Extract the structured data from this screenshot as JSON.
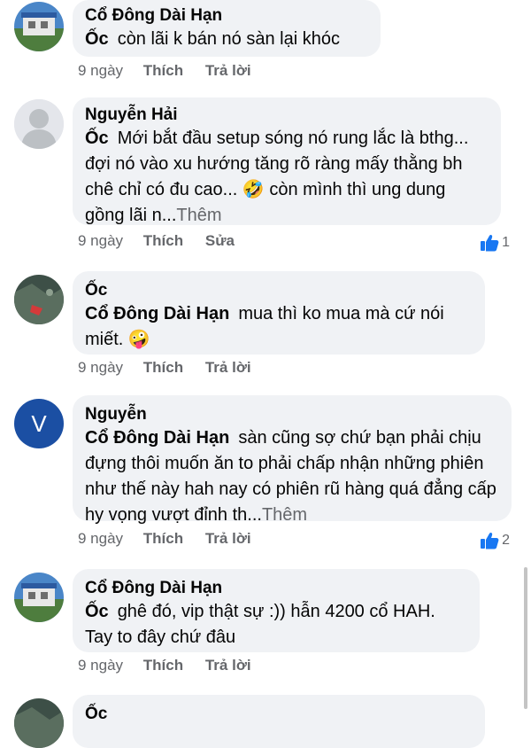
{
  "comments": [
    {
      "author": "Cổ Đông Dài Hạn",
      "tag": "Ốc",
      "text": "còn lãi k bán nó sàn lại khóc",
      "more": "",
      "time": "9 ngày",
      "like_label": "Thích",
      "action_label": "Trả lời",
      "reaction_count": ""
    },
    {
      "author": "Nguyễn Hải",
      "tag": "Ốc",
      "text": "Mới bắt đầu setup sóng nó rung lắc là bthg... đợi nó vào xu hướng tăng rõ ràng mấy thằng bh chê chỉ có đu cao... 🤣 còn mình thì ung dung gồng lãi n...",
      "more": "Thêm",
      "time": "9 ngày",
      "like_label": "Thích",
      "action_label": "Sửa",
      "reaction_count": "1"
    },
    {
      "author": "Ốc",
      "tag": "Cổ Đông Dài Hạn",
      "text": "mua thì ko mua mà cứ nói miết. 🤪",
      "more": "",
      "time": "9 ngày",
      "like_label": "Thích",
      "action_label": "Trả lời",
      "reaction_count": ""
    },
    {
      "author": "Nguyễn",
      "tag": "Cổ Đông Dài Hạn",
      "text": "sàn cũng sợ chứ bạn phải chịu đựng thôi muốn ăn to phải chấp nhận những phiên như thế này hah nay có phiên rũ hàng quá đẳng cấp hy vọng vượt đỉnh th...",
      "more": "Thêm",
      "time": "9 ngày",
      "like_label": "Thích",
      "action_label": "Trả lời",
      "reaction_count": "2",
      "avatar_letter": "V"
    },
    {
      "author": "Cổ Đông Dài Hạn",
      "tag": "Ốc",
      "text": "ghê đó, vip thật sự :)) hẫn 4200 cổ HAH. Tay to đây chứ đâu",
      "more": "",
      "time": "9 ngày",
      "like_label": "Thích",
      "action_label": "Trả lời",
      "reaction_count": ""
    },
    {
      "author": "Ốc",
      "tag": "",
      "text": "",
      "more": "",
      "time": "",
      "like_label": "",
      "action_label": "",
      "reaction_count": ""
    }
  ],
  "colors": {
    "bubble": "#f0f2f5",
    "muted": "#65676b",
    "like_blue": "#1877f2",
    "avatar_v": "#1b4fa3"
  }
}
